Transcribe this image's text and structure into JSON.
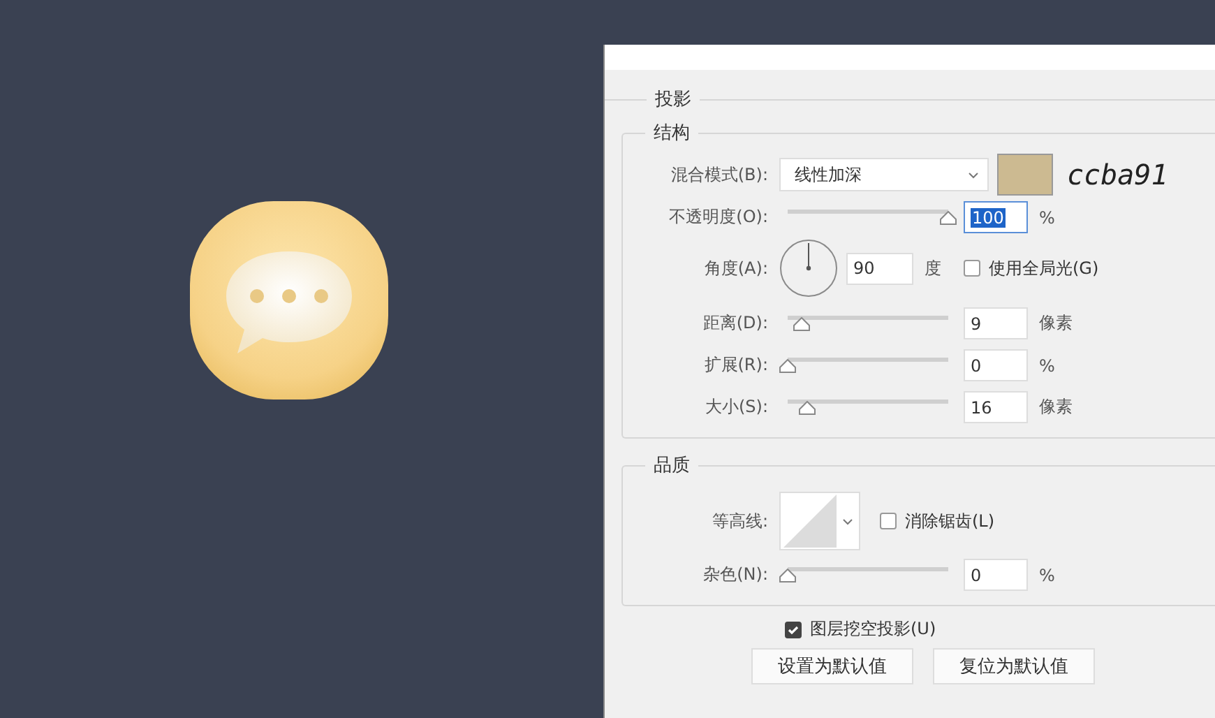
{
  "dialog": {
    "section_title": "投影",
    "structure": {
      "title": "结构",
      "blend_mode": {
        "label": "混合模式(B):",
        "value": "线性加深",
        "color": "#ccba91",
        "color_note": "ccba91"
      },
      "opacity": {
        "label": "不透明度(O):",
        "level": 1,
        "value": "100",
        "unit": "%"
      },
      "angle": {
        "label": "角度(A):",
        "value": "90",
        "unit": "度",
        "global_light": {
          "label": "使用全局光(G)",
          "checked": false
        }
      },
      "sliders": [
        {
          "label": "距离(D):",
          "level": 0.09,
          "value": "9",
          "unit": "像素"
        },
        {
          "label": "扩展(R):",
          "level": 0,
          "value": "0",
          "unit": "%"
        },
        {
          "label": "大小(S):",
          "level": 0.12,
          "value": "16",
          "unit": "像素"
        }
      ]
    },
    "quality": {
      "title": "品质",
      "contour": {
        "label": "等高线:"
      },
      "anti_alias": {
        "label": "消除锯齿(L)",
        "checked": false
      },
      "noise": {
        "label": "杂色(N):",
        "level": 0,
        "value": "0",
        "unit": "%"
      }
    },
    "knockout": {
      "label": "图层挖空投影(U)",
      "checked": true
    },
    "buttons": [
      "设置为默认值",
      "复位为默认值"
    ]
  }
}
